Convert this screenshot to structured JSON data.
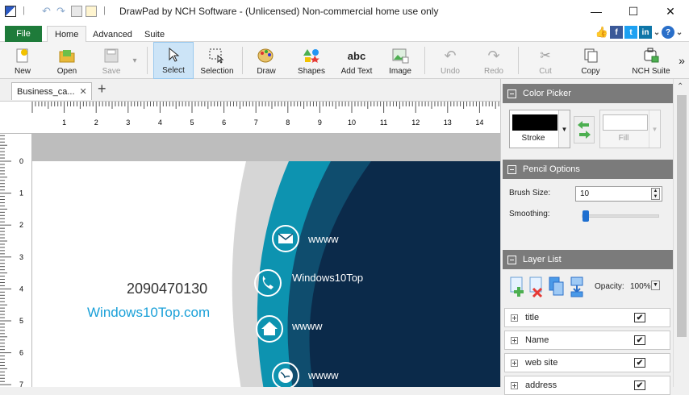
{
  "window": {
    "title": "DrawPad by NCH Software - (Unlicensed) Non-commercial home use only",
    "minimize": "—",
    "maximize": "☐",
    "close": "✕"
  },
  "menu": {
    "file": "File",
    "tabs": [
      "Home",
      "Advanced",
      "Suite"
    ]
  },
  "ribbon": {
    "new": "New",
    "open": "Open",
    "save": "Save",
    "select": "Select",
    "selection": "Selection",
    "draw": "Draw",
    "shapes": "Shapes",
    "add_text": "Add Text",
    "add_text_icon": "abc",
    "image": "Image",
    "undo": "Undo",
    "redo": "Redo",
    "cut": "Cut",
    "copy": "Copy",
    "nch_suite": "NCH Suite",
    "more": "»"
  },
  "doc_tab": {
    "name": "Business_ca...",
    "close": "✕",
    "add": "+"
  },
  "rulers": {
    "h_labels": [
      "1",
      "2",
      "3",
      "4",
      "5",
      "6",
      "7",
      "8",
      "9",
      "10",
      "11",
      "12",
      "13",
      "14"
    ],
    "v_labels": [
      "0",
      "1",
      "2",
      "3",
      "4",
      "5",
      "6",
      "7"
    ]
  },
  "card": {
    "phone": "2090470130",
    "website": "Windows10Top.com",
    "rows": [
      "wwww",
      "Windows10Top",
      "wwww",
      "wwww"
    ],
    "colors": {
      "teal": "#0d93b0",
      "navy": "#0b2a4a",
      "mid": "#0f4d6e",
      "grey": "#d6d6d6",
      "site": "#1aa0d8"
    }
  },
  "color_picker": {
    "title": "Color Picker",
    "stroke": "Stroke",
    "fill": "Fill"
  },
  "pencil": {
    "title": "Pencil Options",
    "brush_label": "Brush Size:",
    "brush_value": "10",
    "smoothing_label": "Smoothing:"
  },
  "layers": {
    "title": "Layer List",
    "opacity_label": "Opacity:",
    "opacity_value": "100%",
    "items": [
      "title",
      "Name",
      "web site",
      "address"
    ]
  }
}
